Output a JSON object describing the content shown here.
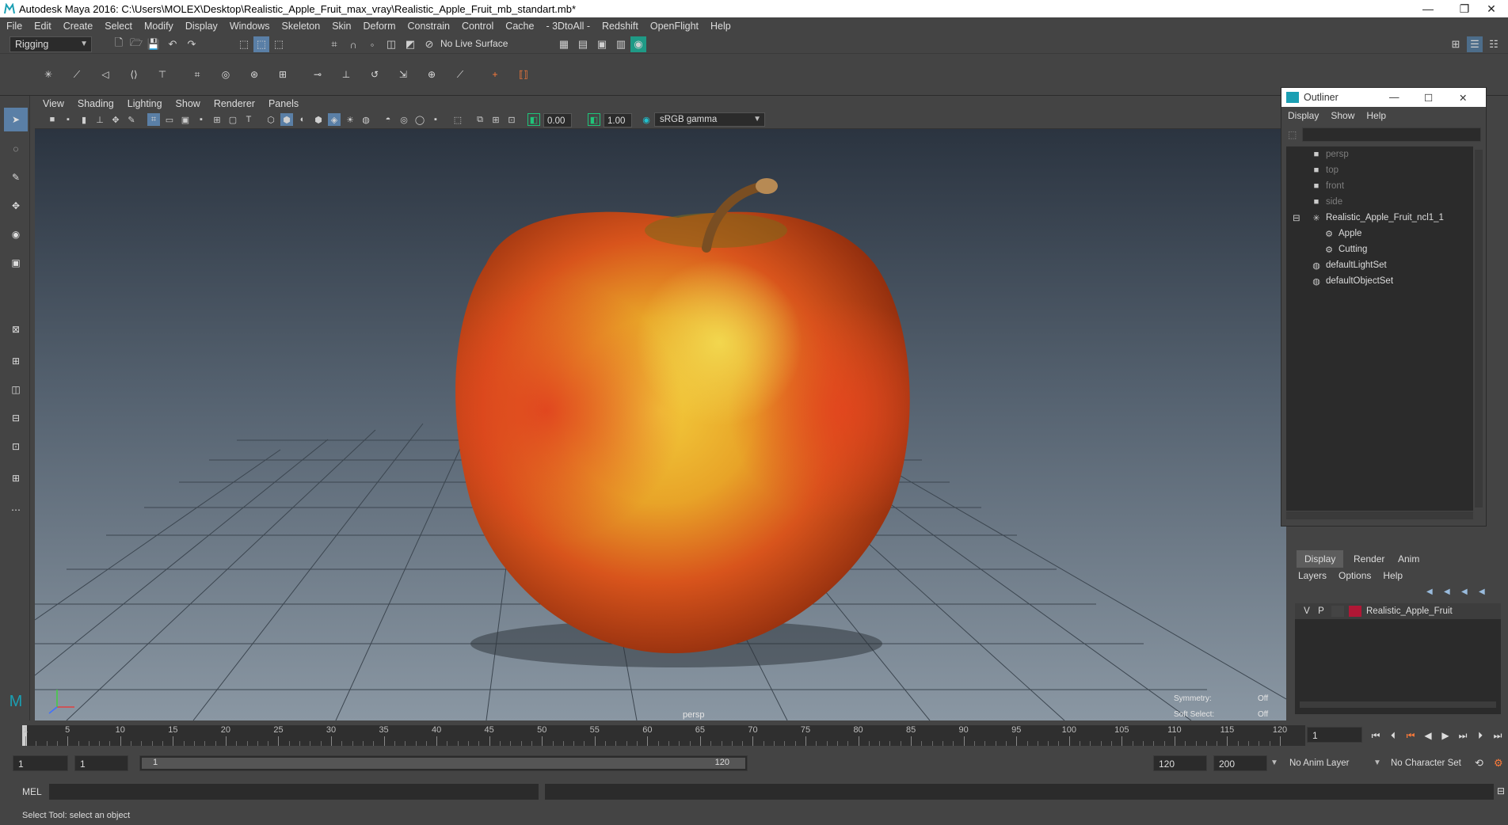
{
  "window": {
    "title": "Autodesk Maya 2016: C:\\Users\\MOLEX\\Desktop\\Realistic_Apple_Fruit_max_vray\\Realistic_Apple_Fruit_mb_standart.mb*",
    "minimize": "—",
    "restore": "❐",
    "close": "✕"
  },
  "menubar": [
    "File",
    "Edit",
    "Create",
    "Select",
    "Modify",
    "Display",
    "Windows",
    "Skeleton",
    "Skin",
    "Deform",
    "Constrain",
    "Control",
    "Cache",
    "- 3DtoAll -",
    "Redshift",
    "OpenFlight",
    "Help"
  ],
  "statusline": {
    "menuset": "Rigging",
    "live_surface": "No Live Surface"
  },
  "panel": {
    "menu": [
      "View",
      "Shading",
      "Lighting",
      "Show",
      "Renderer",
      "Panels"
    ],
    "gamma_value_1": "0.00",
    "gamma_value_2": "1.00",
    "color_space": "sRGB gamma"
  },
  "viewport": {
    "camera": "persp",
    "symmetry_label": "Symmetry:",
    "symmetry_value": "Off",
    "soft_select_label": "Soft Select:",
    "soft_select_value": "Off"
  },
  "outliner": {
    "title": "Outliner",
    "menu": [
      "Display",
      "Show",
      "Help"
    ],
    "items": [
      {
        "label": "persp",
        "dim": true
      },
      {
        "label": "top",
        "dim": true
      },
      {
        "label": "front",
        "dim": true
      },
      {
        "label": "side",
        "dim": true
      },
      {
        "label": "Realistic_Apple_Fruit_ncl1_1",
        "dim": false
      },
      {
        "label": "Apple",
        "dim": false
      },
      {
        "label": "Cutting",
        "dim": false
      },
      {
        "label": "defaultLightSet",
        "dim": false
      },
      {
        "label": "defaultObjectSet",
        "dim": false
      }
    ]
  },
  "layers": {
    "tabs": [
      "Display",
      "Render",
      "Anim"
    ],
    "menu": [
      "Layers",
      "Options",
      "Help"
    ],
    "row": {
      "v": "V",
      "p": "P",
      "name": "Realistic_Apple_Fruit",
      "color": "#b01735"
    }
  },
  "timeline": {
    "ticks": [
      "1",
      "5",
      "10",
      "15",
      "20",
      "25",
      "30",
      "35",
      "40",
      "45",
      "50",
      "55",
      "60",
      "65",
      "70",
      "75",
      "80",
      "85",
      "90",
      "95",
      "100",
      "105",
      "110",
      "115",
      "120"
    ],
    "current_frame": "1"
  },
  "range": {
    "start": "1",
    "playback_start": "1",
    "bar_start": "1",
    "bar_end": "120",
    "playback_end": "120",
    "end": "200",
    "anim_layer": "No Anim Layer",
    "character_set": "No Character Set"
  },
  "cmdline": {
    "lang": "MEL"
  },
  "helpline": {
    "text": "Select Tool: select an object"
  }
}
